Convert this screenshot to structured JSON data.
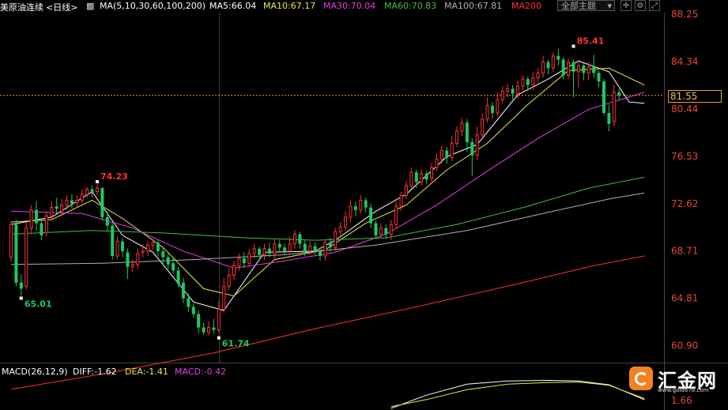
{
  "header": {
    "symbol": "美原油连续",
    "period": "<日线>",
    "ma_params": "MA(5,10,30,60,100,200)",
    "ma5": "MA5:66.04",
    "ma10": "MA10:67.17",
    "ma30": "MA30:70.04",
    "ma60": "MA60:70.83",
    "ma100": "MA100:67.81",
    "ma200": "MA200",
    "theme_button": "全部主题"
  },
  "colors": {
    "up": "#ff3232",
    "down": "#1fc861",
    "ma5": "#ffffff",
    "ma10": "#e8e84a",
    "ma30": "#e040e0",
    "ma60": "#40c040",
    "ma100": "#b0b0b0",
    "ma200": "#ff3030",
    "axis_text": "#e8473a",
    "current_price_line": "#e8a030"
  },
  "price_axis": {
    "labels": [
      "88.25",
      "84.34",
      "80.44",
      "76.53",
      "72.62",
      "68.71",
      "64.81",
      "60.90"
    ],
    "current_price": "81.55"
  },
  "macd": {
    "params": "MACD(26,12,9)",
    "diff": "DIFF:-1.62",
    "dea": "DEA:-1.41",
    "macd": "MACD:-0.42",
    "axis_label": "1.66"
  },
  "watermark": {
    "name": "汇金网",
    "url": "www.gold678.com"
  },
  "chart_data": {
    "type": "candlestick",
    "title": "美原油连续 <日线>",
    "ylim": [
      59.5,
      88.25
    ],
    "annotations": [
      {
        "label": "74.23",
        "kind": "high",
        "value": 74.23,
        "candle_index": 17
      },
      {
        "label": "65.01",
        "kind": "low",
        "value": 65.01,
        "candle_index": 2
      },
      {
        "label": "61.74",
        "kind": "low",
        "value": 61.74,
        "candle_index": 41
      },
      {
        "label": "85.41",
        "kind": "high",
        "value": 85.41,
        "candle_index": 111
      }
    ],
    "candles": [
      [
        68.2,
        70.9,
        71.2,
        67.8
      ],
      [
        70.9,
        66.1,
        71.3,
        65.8
      ],
      [
        66.1,
        65.6,
        66.8,
        65.0
      ],
      [
        65.8,
        70.6,
        71.1,
        65.5
      ],
      [
        70.6,
        72.1,
        72.5,
        70.2
      ],
      [
        72.1,
        71.0,
        72.8,
        70.4
      ],
      [
        71.0,
        70.0,
        71.4,
        69.6
      ],
      [
        70.2,
        71.6,
        72.0,
        69.9
      ],
      [
        71.6,
        72.3,
        72.8,
        71.2
      ],
      [
        72.4,
        72.2,
        73.1,
        71.8
      ],
      [
        72.0,
        72.5,
        73.0,
        71.7
      ],
      [
        72.5,
        72.9,
        73.3,
        72.1
      ],
      [
        72.9,
        72.6,
        73.4,
        72.2
      ],
      [
        72.7,
        72.9,
        73.3,
        72.3
      ],
      [
        72.9,
        73.4,
        73.8,
        72.6
      ],
      [
        73.4,
        73.8,
        74.0,
        73.1
      ],
      [
        73.8,
        73.6,
        74.1,
        73.1
      ],
      [
        73.6,
        73.9,
        74.23,
        73.3
      ],
      [
        73.9,
        71.5,
        74.0,
        71.2
      ],
      [
        71.5,
        70.8,
        72.0,
        70.3
      ],
      [
        70.8,
        68.3,
        71.1,
        68.0
      ],
      [
        68.3,
        69.5,
        69.9,
        68.0
      ],
      [
        69.5,
        68.7,
        69.8,
        68.2
      ],
      [
        68.6,
        67.4,
        68.9,
        66.4
      ],
      [
        67.4,
        67.6,
        68.0,
        67.0
      ],
      [
        67.6,
        68.5,
        68.9,
        67.2
      ],
      [
        68.6,
        68.7,
        69.3,
        68.2
      ],
      [
        68.7,
        69.2,
        69.5,
        68.3
      ],
      [
        69.2,
        69.4,
        69.7,
        68.8
      ],
      [
        69.4,
        68.7,
        69.6,
        68.3
      ],
      [
        68.7,
        68.2,
        69.0,
        67.6
      ],
      [
        68.2,
        67.6,
        68.5,
        67.2
      ],
      [
        67.7,
        67.1,
        68.1,
        66.8
      ],
      [
        67.1,
        66.0,
        67.4,
        65.7
      ],
      [
        66.1,
        64.8,
        66.5,
        64.4
      ],
      [
        64.8,
        64.1,
        65.2,
        63.7
      ],
      [
        64.1,
        63.5,
        64.4,
        63.2
      ],
      [
        63.5,
        62.4,
        63.8,
        61.9
      ],
      [
        62.4,
        62.0,
        62.8,
        61.8
      ],
      [
        62.0,
        62.4,
        62.9,
        61.74
      ],
      [
        62.4,
        62.2,
        63.1,
        61.9
      ],
      [
        62.2,
        63.9,
        64.6,
        62.0
      ],
      [
        63.9,
        65.8,
        66.5,
        63.6
      ],
      [
        65.8,
        66.7,
        67.3,
        65.5
      ],
      [
        66.7,
        67.5,
        67.9,
        66.3
      ],
      [
        67.5,
        68.1,
        68.5,
        67.1
      ],
      [
        68.1,
        67.7,
        68.6,
        67.3
      ],
      [
        67.7,
        68.5,
        68.9,
        67.4
      ],
      [
        68.5,
        68.9,
        69.3,
        68.1
      ],
      [
        68.9,
        68.4,
        69.1,
        67.9
      ],
      [
        68.4,
        68.9,
        69.3,
        68.0
      ],
      [
        68.9,
        68.5,
        69.4,
        68.2
      ],
      [
        68.5,
        69.3,
        69.7,
        68.0
      ],
      [
        69.3,
        69.0,
        69.6,
        68.6
      ],
      [
        69.0,
        68.7,
        69.3,
        68.4
      ],
      [
        68.7,
        69.3,
        69.9,
        68.5
      ],
      [
        69.3,
        70.1,
        70.4,
        68.9
      ],
      [
        70.1,
        69.3,
        70.3,
        68.9
      ],
      [
        69.3,
        68.7,
        69.6,
        68.3
      ],
      [
        68.7,
        69.1,
        69.5,
        68.4
      ],
      [
        69.1,
        68.7,
        69.4,
        68.4
      ],
      [
        68.7,
        68.3,
        69.0,
        67.9
      ],
      [
        68.3,
        69.4,
        69.7,
        67.9
      ],
      [
        69.4,
        69.0,
        69.8,
        68.6
      ],
      [
        69.0,
        70.3,
        70.6,
        68.7
      ],
      [
        70.3,
        70.7,
        71.1,
        70.0
      ],
      [
        70.7,
        71.5,
        72.0,
        70.4
      ],
      [
        71.5,
        72.4,
        72.9,
        71.1
      ],
      [
        72.4,
        72.1,
        72.8,
        71.6
      ],
      [
        72.1,
        72.9,
        73.3,
        71.8
      ],
      [
        72.9,
        72.3,
        73.1,
        71.9
      ],
      [
        72.3,
        71.0,
        72.6,
        70.6
      ],
      [
        71.0,
        70.0,
        71.2,
        69.7
      ],
      [
        70.1,
        70.6,
        71.0,
        69.8
      ],
      [
        70.6,
        70.1,
        70.9,
        69.7
      ],
      [
        70.1,
        70.9,
        71.3,
        69.6
      ],
      [
        70.9,
        72.4,
        72.8,
        70.6
      ],
      [
        72.4,
        73.3,
        73.6,
        72.0
      ],
      [
        73.3,
        74.1,
        74.5,
        73.0
      ],
      [
        74.1,
        75.2,
        75.6,
        73.8
      ],
      [
        75.2,
        74.4,
        75.4,
        73.9
      ],
      [
        74.4,
        75.1,
        75.5,
        74.1
      ],
      [
        75.1,
        74.6,
        75.3,
        74.2
      ],
      [
        74.7,
        75.6,
        76.0,
        74.3
      ],
      [
        75.6,
        76.3,
        76.8,
        75.3
      ],
      [
        76.3,
        77.0,
        77.4,
        75.9
      ],
      [
        77.0,
        76.4,
        77.3,
        75.9
      ],
      [
        76.4,
        77.6,
        78.2,
        76.1
      ],
      [
        77.6,
        78.6,
        79.0,
        77.3
      ],
      [
        78.6,
        79.3,
        79.7,
        78.2
      ],
      [
        79.3,
        77.7,
        79.6,
        76.9
      ],
      [
        77.7,
        76.6,
        78.0,
        74.9
      ],
      [
        76.6,
        78.3,
        79.0,
        76.2
      ],
      [
        78.3,
        79.6,
        80.1,
        78.0
      ],
      [
        79.6,
        80.7,
        81.4,
        79.3
      ],
      [
        80.7,
        80.1,
        81.0,
        79.6
      ],
      [
        80.1,
        81.2,
        81.8,
        79.8
      ],
      [
        81.2,
        81.9,
        82.3,
        80.9
      ],
      [
        81.9,
        82.1,
        82.5,
        81.4
      ],
      [
        82.1,
        81.7,
        82.4,
        81.2
      ],
      [
        81.7,
        82.3,
        82.8,
        81.3
      ],
      [
        82.3,
        82.9,
        83.2,
        81.9
      ],
      [
        82.9,
        82.4,
        83.1,
        81.9
      ],
      [
        82.4,
        83.0,
        83.5,
        82.0
      ],
      [
        83.0,
        83.4,
        83.8,
        82.6
      ],
      [
        83.4,
        84.3,
        84.8,
        83.0
      ],
      [
        84.3,
        83.8,
        84.5,
        83.3
      ],
      [
        83.8,
        84.8,
        85.1,
        83.5
      ],
      [
        84.8,
        84.5,
        85.41,
        84.0
      ],
      [
        84.5,
        83.2,
        84.7,
        82.9
      ],
      [
        83.2,
        84.3,
        84.6,
        82.9
      ],
      [
        84.3,
        83.5,
        84.5,
        81.4
      ],
      [
        83.5,
        84.0,
        84.5,
        82.2
      ],
      [
        84.0,
        83.4,
        84.2,
        82.8
      ],
      [
        83.4,
        83.9,
        84.3,
        82.8
      ],
      [
        83.9,
        83.4,
        84.9,
        83.0
      ],
      [
        83.4,
        82.7,
        83.6,
        82.2
      ],
      [
        82.7,
        80.1,
        82.9,
        79.9
      ],
      [
        80.1,
        79.2,
        80.8,
        78.6
      ],
      [
        79.4,
        81.8,
        82.4,
        79.0
      ],
      [
        81.8,
        81.55,
        82.1,
        81.2
      ]
    ],
    "ma_lines": {
      "MA5": [
        [
          0,
          70.9
        ],
        [
          8,
          71.5
        ],
        [
          16,
          73.6
        ],
        [
          22,
          70.0
        ],
        [
          28,
          68.6
        ],
        [
          36,
          64.5
        ],
        [
          42,
          63.8
        ],
        [
          50,
          68.6
        ],
        [
          60,
          68.7
        ],
        [
          64,
          69.6
        ],
        [
          72,
          72.0
        ],
        [
          78,
          73.4
        ],
        [
          86,
          76.5
        ],
        [
          92,
          77.5
        ],
        [
          100,
          81.6
        ],
        [
          106,
          82.9
        ],
        [
          112,
          84.4
        ],
        [
          118,
          83.5
        ],
        [
          122,
          81.0
        ],
        [
          125,
          80.9
        ]
      ],
      "MA10": [
        [
          0,
          71.1
        ],
        [
          8,
          71.3
        ],
        [
          16,
          72.9
        ],
        [
          22,
          71.4
        ],
        [
          30,
          69.0
        ],
        [
          38,
          65.6
        ],
        [
          44,
          65.0
        ],
        [
          52,
          68.0
        ],
        [
          62,
          68.8
        ],
        [
          70,
          71.0
        ],
        [
          78,
          72.5
        ],
        [
          86,
          75.4
        ],
        [
          94,
          77.6
        ],
        [
          102,
          80.8
        ],
        [
          110,
          83.6
        ],
        [
          118,
          83.8
        ],
        [
          125,
          82.4
        ]
      ],
      "MA30": [
        [
          0,
          72.0
        ],
        [
          14,
          71.8
        ],
        [
          24,
          70.6
        ],
        [
          34,
          68.7
        ],
        [
          44,
          67.3
        ],
        [
          54,
          67.9
        ],
        [
          64,
          68.6
        ],
        [
          74,
          70.1
        ],
        [
          84,
          72.5
        ],
        [
          94,
          75.3
        ],
        [
          104,
          78.0
        ],
        [
          114,
          80.4
        ],
        [
          125,
          81.8
        ]
      ],
      "MA60": [
        [
          0,
          70.1
        ],
        [
          16,
          70.4
        ],
        [
          30,
          70.2
        ],
        [
          46,
          69.8
        ],
        [
          60,
          69.6
        ],
        [
          74,
          69.8
        ],
        [
          88,
          70.9
        ],
        [
          102,
          72.4
        ],
        [
          114,
          73.9
        ],
        [
          125,
          74.8
        ]
      ],
      "MA100": [
        [
          0,
          67.6
        ],
        [
          18,
          67.7
        ],
        [
          36,
          68.0
        ],
        [
          54,
          68.4
        ],
        [
          72,
          69.2
        ],
        [
          90,
          70.4
        ],
        [
          106,
          71.9
        ],
        [
          118,
          73.0
        ],
        [
          125,
          73.5
        ]
      ],
      "MA200": [
        [
          0,
          57.3
        ],
        [
          20,
          58.7
        ],
        [
          40,
          60.3
        ],
        [
          60,
          62.3
        ],
        [
          80,
          64.1
        ],
        [
          100,
          66.0
        ],
        [
          115,
          67.5
        ],
        [
          125,
          68.3
        ]
      ]
    },
    "macd_series": {
      "DIFF": [
        [
          75,
          -3.2
        ],
        [
          82,
          -0.8
        ],
        [
          90,
          1.2
        ],
        [
          98,
          1.8
        ],
        [
          106,
          1.9
        ],
        [
          112,
          1.8
        ],
        [
          118,
          1.1
        ],
        [
          125,
          -1.62
        ]
      ],
      "DEA": [
        [
          75,
          -2.9
        ],
        [
          82,
          -1.6
        ],
        [
          90,
          0.2
        ],
        [
          98,
          1.2
        ],
        [
          106,
          1.5
        ],
        [
          112,
          1.6
        ],
        [
          118,
          1.0
        ],
        [
          125,
          -1.41
        ]
      ]
    }
  }
}
